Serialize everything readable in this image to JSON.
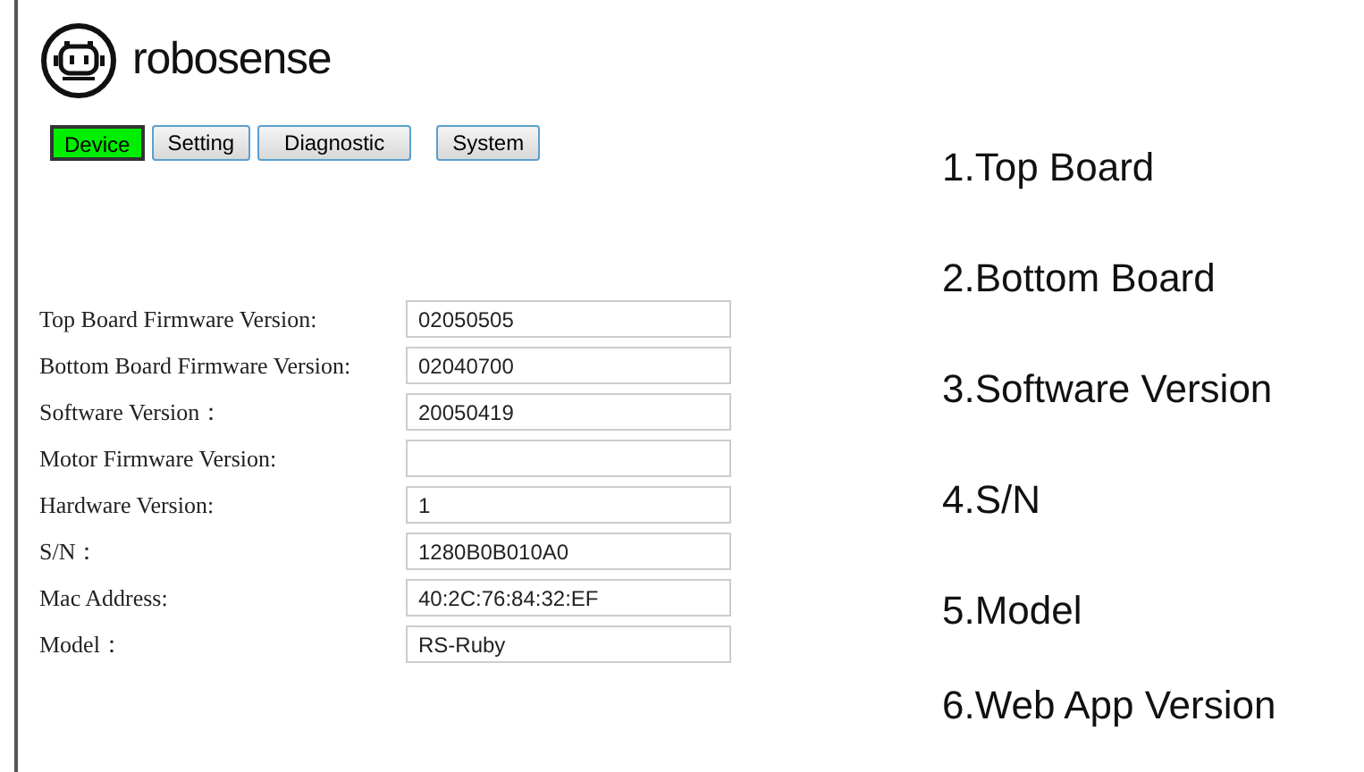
{
  "logo": {
    "text": "robosense"
  },
  "tabs": [
    {
      "label": "Device",
      "selected": true
    },
    {
      "label": "Setting",
      "selected": false
    },
    {
      "label": "Diagnostic",
      "selected": false
    },
    {
      "label": "System",
      "selected": false
    }
  ],
  "fields": [
    {
      "label": "Top Board Firmware Version:",
      "value": "02050505"
    },
    {
      "label": "Bottom Board Firmware Version:",
      "value": "02040700"
    },
    {
      "label": "Software Version：",
      "value": "20050419"
    },
    {
      "label": "Motor Firmware Version:"
    },
    {
      "label": "Hardware Version:",
      "value": "1"
    },
    {
      "label": "S/N：",
      "value": "1280B0B010A0"
    },
    {
      "label": "Mac Address:",
      "value": "40:2C:76:84:32:EF"
    },
    {
      "label": "Model：",
      "value": "RS-Ruby"
    }
  ],
  "annotations": [
    "1.Top Board",
    "2.Bottom Board",
    "3.Software Version",
    "4.S/N",
    "5.Model",
    "6.Web App Version"
  ]
}
